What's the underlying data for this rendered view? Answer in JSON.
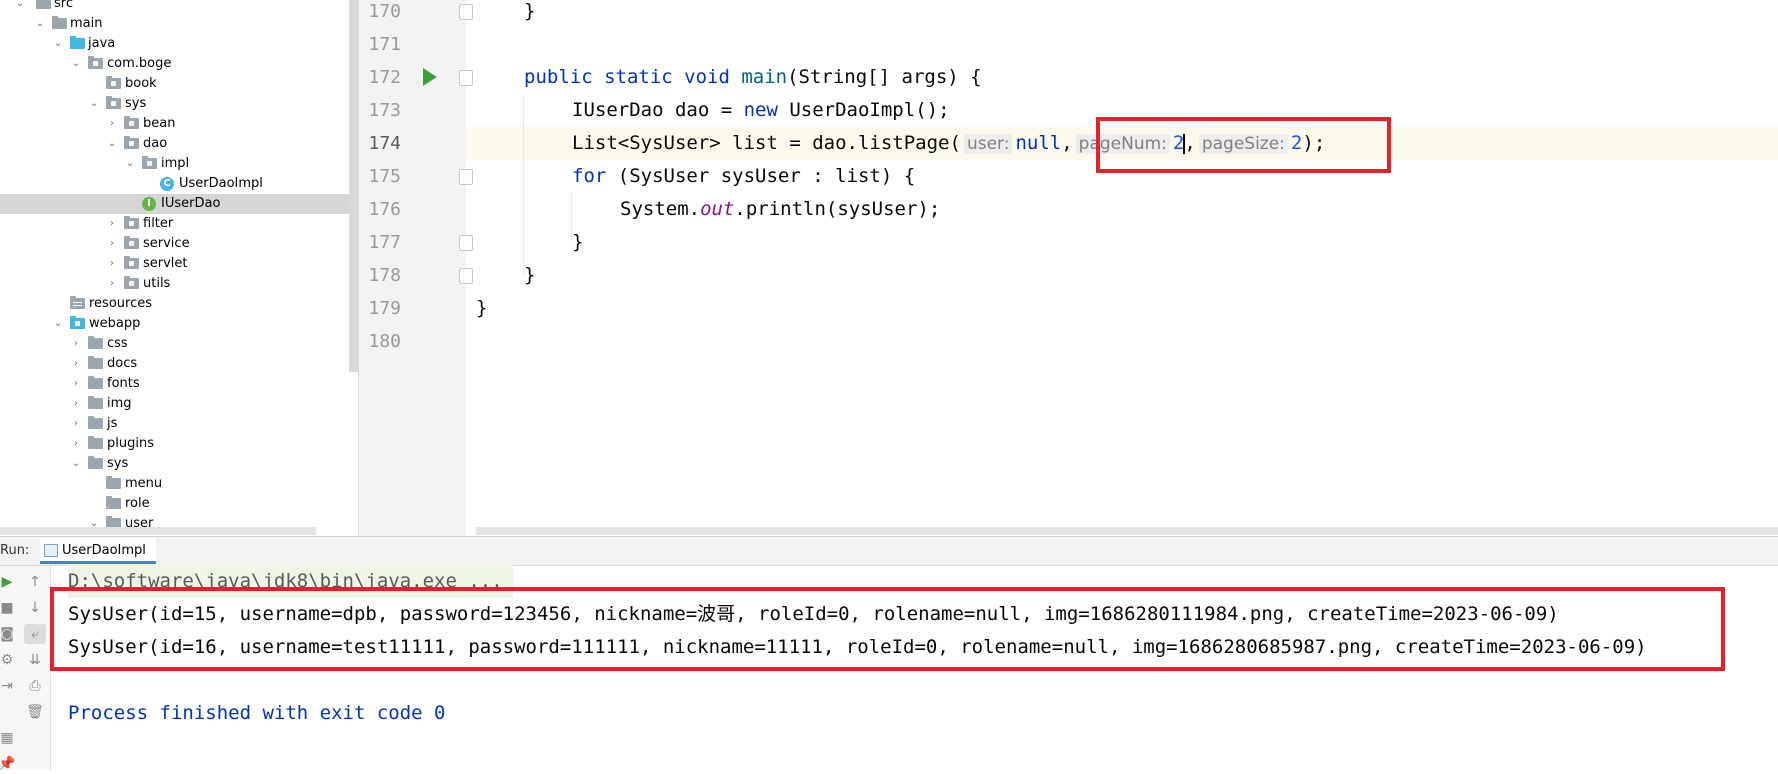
{
  "project_tree": {
    "items": [
      {
        "label": "src",
        "icon": "folder-icon",
        "expanded": true
      },
      {
        "label": "main",
        "icon": "folder-icon",
        "expanded": true
      },
      {
        "label": "java",
        "icon": "source-folder-icon",
        "expanded": true
      },
      {
        "label": "com.boge",
        "icon": "package-icon",
        "expanded": true
      },
      {
        "label": "book",
        "icon": "package-icon"
      },
      {
        "label": "sys",
        "icon": "package-icon",
        "expanded": true
      },
      {
        "label": "bean",
        "icon": "package-icon",
        "expanded": false
      },
      {
        "label": "dao",
        "icon": "package-icon",
        "expanded": true
      },
      {
        "label": "impl",
        "icon": "package-icon",
        "expanded": true
      },
      {
        "label": "UserDaoImpl",
        "icon": "class-icon"
      },
      {
        "label": "IUserDao",
        "icon": "interface-icon",
        "selected": true
      },
      {
        "label": "filter",
        "icon": "package-icon",
        "expanded": false
      },
      {
        "label": "service",
        "icon": "package-icon",
        "expanded": false
      },
      {
        "label": "servlet",
        "icon": "package-icon",
        "expanded": false
      },
      {
        "label": "utils",
        "icon": "package-icon",
        "expanded": false
      },
      {
        "label": "resources",
        "icon": "resources-folder-icon"
      },
      {
        "label": "webapp",
        "icon": "web-folder-icon",
        "expanded": true
      },
      {
        "label": "css",
        "icon": "folder-icon",
        "expanded": false
      },
      {
        "label": "docs",
        "icon": "folder-icon",
        "expanded": false
      },
      {
        "label": "fonts",
        "icon": "folder-icon",
        "expanded": false
      },
      {
        "label": "img",
        "icon": "folder-icon",
        "expanded": false
      },
      {
        "label": "js",
        "icon": "folder-icon",
        "expanded": false
      },
      {
        "label": "plugins",
        "icon": "folder-icon",
        "expanded": false
      },
      {
        "label": "sys",
        "icon": "folder-icon",
        "expanded": true
      },
      {
        "label": "menu",
        "icon": "folder-icon"
      },
      {
        "label": "role",
        "icon": "folder-icon"
      },
      {
        "label": "user",
        "icon": "folder-icon",
        "expanded": true
      }
    ]
  },
  "editor": {
    "line_numbers": [
      "170",
      "171",
      "172",
      "173",
      "174",
      "175",
      "176",
      "177",
      "178",
      "179",
      "180"
    ],
    "current_line": "174",
    "code": {
      "l170": "}",
      "l172_kw": "public static void ",
      "l172_method": "main",
      "l172_rest": "(String[] args) {",
      "l173_a": "IUserDao dao = ",
      "l173_kw": "new",
      "l173_b": " UserDaoImpl();",
      "l174_a": "List<SysUser> list = dao.listPage(",
      "l174_hint_user": "user:",
      "l174_null": "null",
      "l174_comma1": ",",
      "l174_hint_pagenum": "pageNum:",
      "l174_pagenum": "2",
      "l174_comma2": ",",
      "l174_hint_pagesize": "pageSize:",
      "l174_pagesize": "2",
      "l174_end": ");",
      "l175_kw": "for",
      "l175_rest": " (SysUser sysUser : list) {",
      "l176_a": "System.",
      "l176_field": "out",
      "l176_b": ".println(sysUser);",
      "l177": "}",
      "l178": "}",
      "l179": "}"
    }
  },
  "run_panel": {
    "title": "Run:",
    "tab_label": "UserDaoImpl",
    "command": "D:\\software\\java\\jdk8\\bin\\java.exe ...",
    "output": [
      "SysUser(id=15, username=dpb, password=123456, nickname=波哥, roleId=0, rolename=null, img=1686280111984.png, createTime=2023-06-09)",
      "SysUser(id=16, username=test11111, password=111111, nickname=11111, roleId=0, rolename=null, img=1686280685987.png, createTime=2023-06-09)"
    ],
    "exit_message": "Process finished with exit code 0"
  },
  "colors": {
    "highlight_box": "#e8202a",
    "keyword": "#0033b3",
    "run_green": "#3f9f3f"
  }
}
